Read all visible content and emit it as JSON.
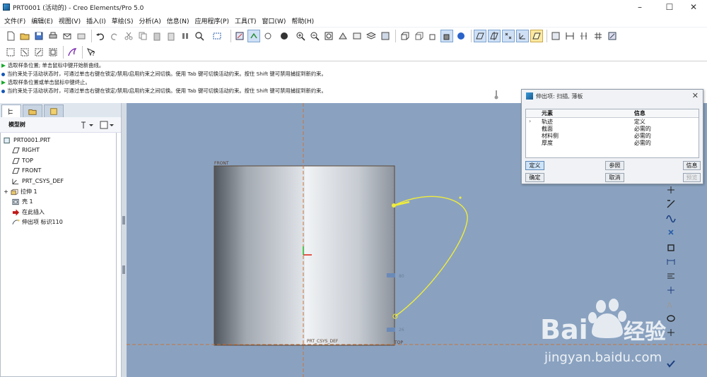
{
  "window": {
    "title": "PRT0001 (活动的) - Creo Elements/Pro 5.0",
    "minimize": "–",
    "maximize": "☐",
    "close": "✕"
  },
  "menu": [
    "文件(F)",
    "编辑(E)",
    "视图(V)",
    "插入(I)",
    "草绘(S)",
    "分析(A)",
    "信息(N)",
    "应用程序(P)",
    "工具(T)",
    "窗口(W)",
    "帮助(H)"
  ],
  "messages": [
    {
      "icon": "arrow",
      "text": "选取样条位置; 单击鼠标中键开始新曲线。"
    },
    {
      "icon": "dot",
      "text": "当约束处于活动状态时，可通过单击右键在锁定/禁用/启用约束之间切换。使用 Tab 键可切换活动约束。按住 Shift 键可禁用捕捉到新约束。"
    },
    {
      "icon": "arrow",
      "text": "选取样条位置或单击鼠标中键终止。"
    },
    {
      "icon": "dot",
      "text": "当约束处于活动状态时，可通过单击右键在锁定/禁用/启用约束之间切换。使用 Tab 键可切换活动约束。按住 Shift 键可禁用捕捉到新约束。"
    }
  ],
  "model_tree": {
    "header": "模型树",
    "items": [
      {
        "label": "PRT0001.PRT",
        "icon": "part"
      },
      {
        "label": "RIGHT",
        "icon": "datum-plane"
      },
      {
        "label": "TOP",
        "icon": "datum-plane"
      },
      {
        "label": "FRONT",
        "icon": "datum-plane"
      },
      {
        "label": "PRT_CSYS_DEF",
        "icon": "csys"
      },
      {
        "label": "拉伸 1",
        "icon": "extrude"
      },
      {
        "label": "壳 1",
        "icon": "shell"
      },
      {
        "label": "在此插入",
        "icon": "insert-here"
      },
      {
        "label": "伸出项 标识110",
        "icon": "sweep"
      }
    ]
  },
  "viewport": {
    "plane_labels": {
      "front": "FRONT",
      "csys": "PRT_CSYS_DEF",
      "top": "TOP"
    },
    "dims": {
      "d1": "80",
      "d2": "26"
    },
    "colors": {
      "background": "#8aa2c0",
      "spline": "#f0ec3a",
      "datum": "#c8743a"
    }
  },
  "dialog": {
    "title": "伸出项: 扫描, 薄板",
    "col_element": "元素",
    "col_info": "信息",
    "rows": [
      {
        "element": "轨迹",
        "info": "定义"
      },
      {
        "element": "截面",
        "info": "必需的"
      },
      {
        "element": "材料侧",
        "info": "必需的"
      },
      {
        "element": "厚度",
        "info": "必需的"
      }
    ],
    "buttons": {
      "define": "定义",
      "refs": "参照",
      "info": "信息",
      "ok": "确定",
      "cancel": "取消",
      "preview": "预览"
    }
  },
  "watermark": {
    "brand": "Bai",
    "brand2": "经验",
    "url": "jingyan.baidu.com"
  }
}
